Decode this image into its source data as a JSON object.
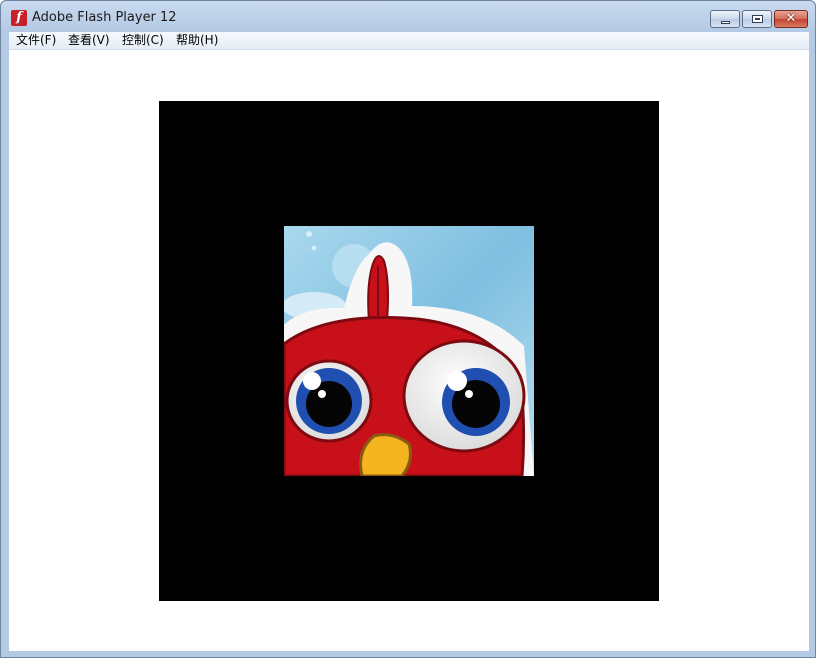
{
  "window": {
    "title": "Adobe Flash Player 12",
    "app_icon_glyph": "f",
    "controls": {
      "minimize": "minimize-icon",
      "maximize": "maximize-icon",
      "close_glyph": "✕"
    }
  },
  "menubar": {
    "items": [
      {
        "label": "文件(F)"
      },
      {
        "label": "查看(V)"
      },
      {
        "label": "控制(C)"
      },
      {
        "label": "帮助(H)"
      }
    ]
  },
  "content": {
    "stage_color": "#000000",
    "image": {
      "subject": "red-cartoon-bird-icon",
      "colors": {
        "sky": "#8ec7e2",
        "bird_red": "#c8101b",
        "eye_blue": "#1f4fb0",
        "beak": "#f4b520"
      }
    }
  }
}
